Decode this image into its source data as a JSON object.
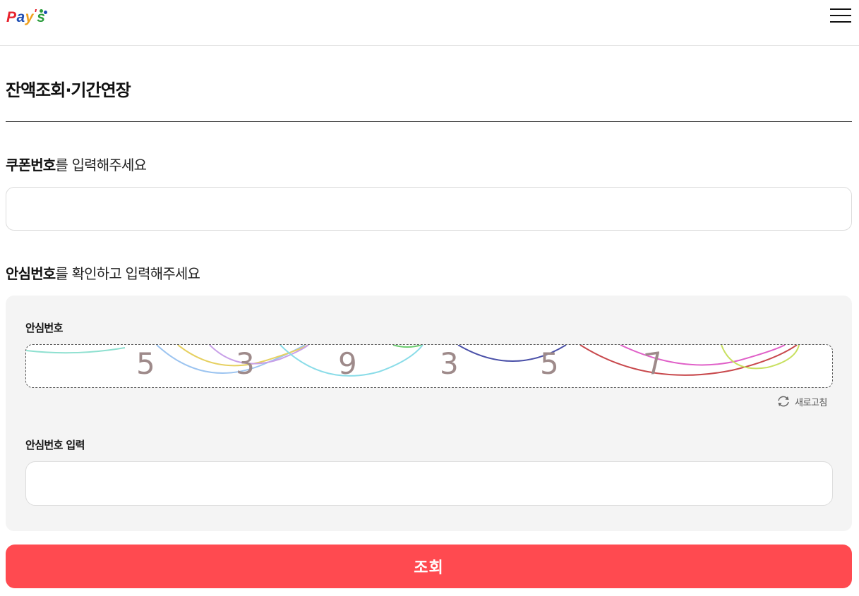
{
  "header": {
    "logo_text": "Pay's",
    "menu_icon": "hamburger-menu-icon"
  },
  "page": {
    "title": "잔액조회·기간연장"
  },
  "coupon": {
    "label_bold": "쿠폰번호",
    "label_rest": "를 입력해주세요",
    "input_value": ""
  },
  "captcha": {
    "section_label_bold": "안심번호",
    "section_label_rest": "를 확인하고 입력해주세요",
    "image_label": "안심번호",
    "digits": [
      "5",
      "3",
      "9",
      "3",
      "5",
      "7"
    ],
    "refresh_label": "새로고침",
    "refresh_icon": "refresh-icon",
    "input_label": "안심번호 입력",
    "input_value": ""
  },
  "submit": {
    "label": "조회"
  },
  "colors": {
    "accent": "#ff4a50",
    "panel_bg": "#f4f4f4"
  }
}
